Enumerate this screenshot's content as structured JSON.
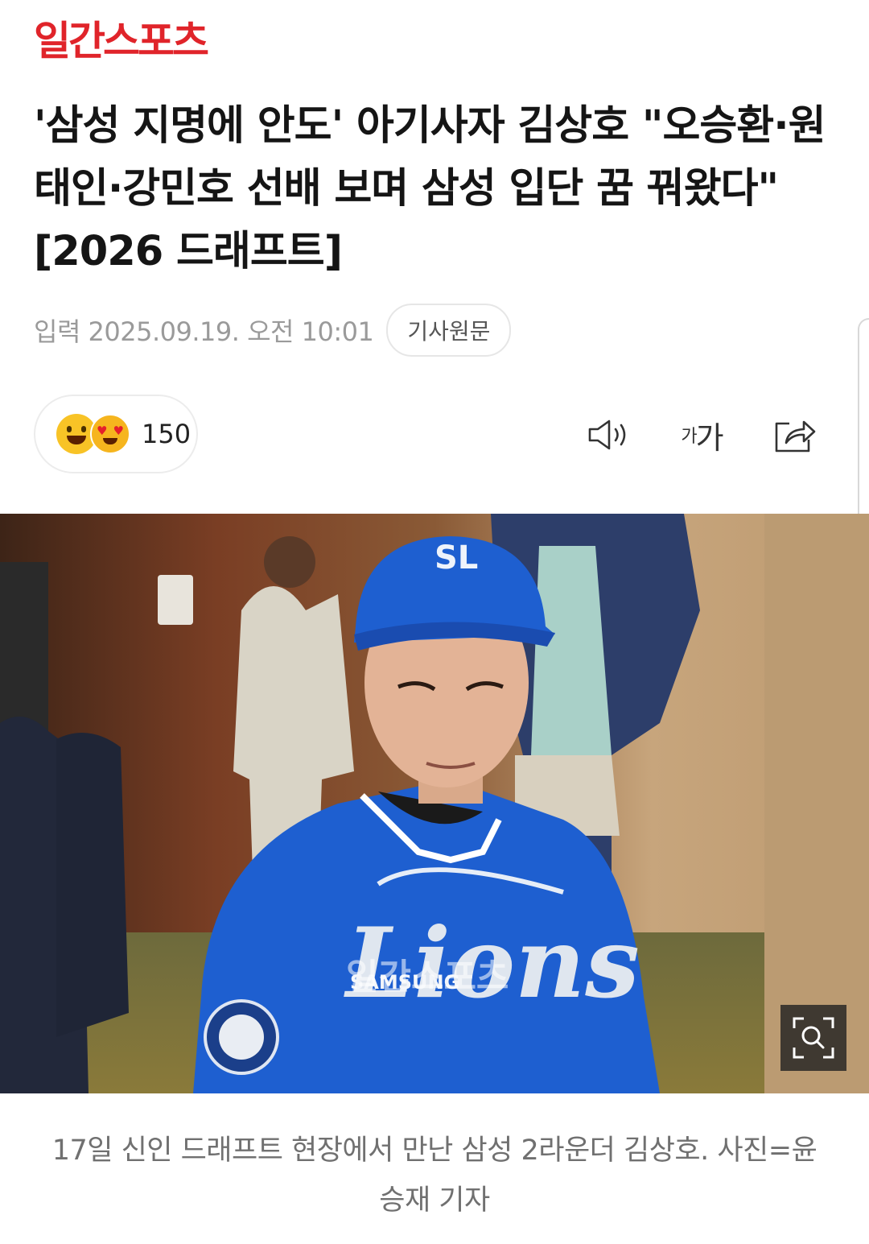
{
  "brand": {
    "logo_text": "일간스포츠",
    "logo_color": "#e0242a"
  },
  "article": {
    "headline": "'삼성 지명에 안도' 아기사자 김상호 \"오승환·원태인·강민호 선배 보며 삼성 입단 꿈 꿔왔다\" [2026 드래프트]",
    "published": "입력 2025.09.19. 오전 10:01",
    "original_link_label": "기사원문"
  },
  "reactions": {
    "count": "150",
    "emojis": [
      "grinning-face-emoji",
      "heart-eyes-emoji"
    ]
  },
  "toolbar": {
    "tts_icon": "speaker-icon",
    "font_size_small": "가",
    "font_size_big": "가",
    "share_icon": "share-icon"
  },
  "photo": {
    "description_icons": [
      "zoom-icon"
    ],
    "cap_logo": "SL",
    "jersey_text": "Lions",
    "jersey_brand": "SAMSUNG",
    "watermark": "일간스포츠",
    "jersey_color": "#1e5fd0"
  },
  "caption": "17일 신인 드래프트 현장에서 만난 삼성 2라운더 김상호. 사진=윤승재 기자"
}
